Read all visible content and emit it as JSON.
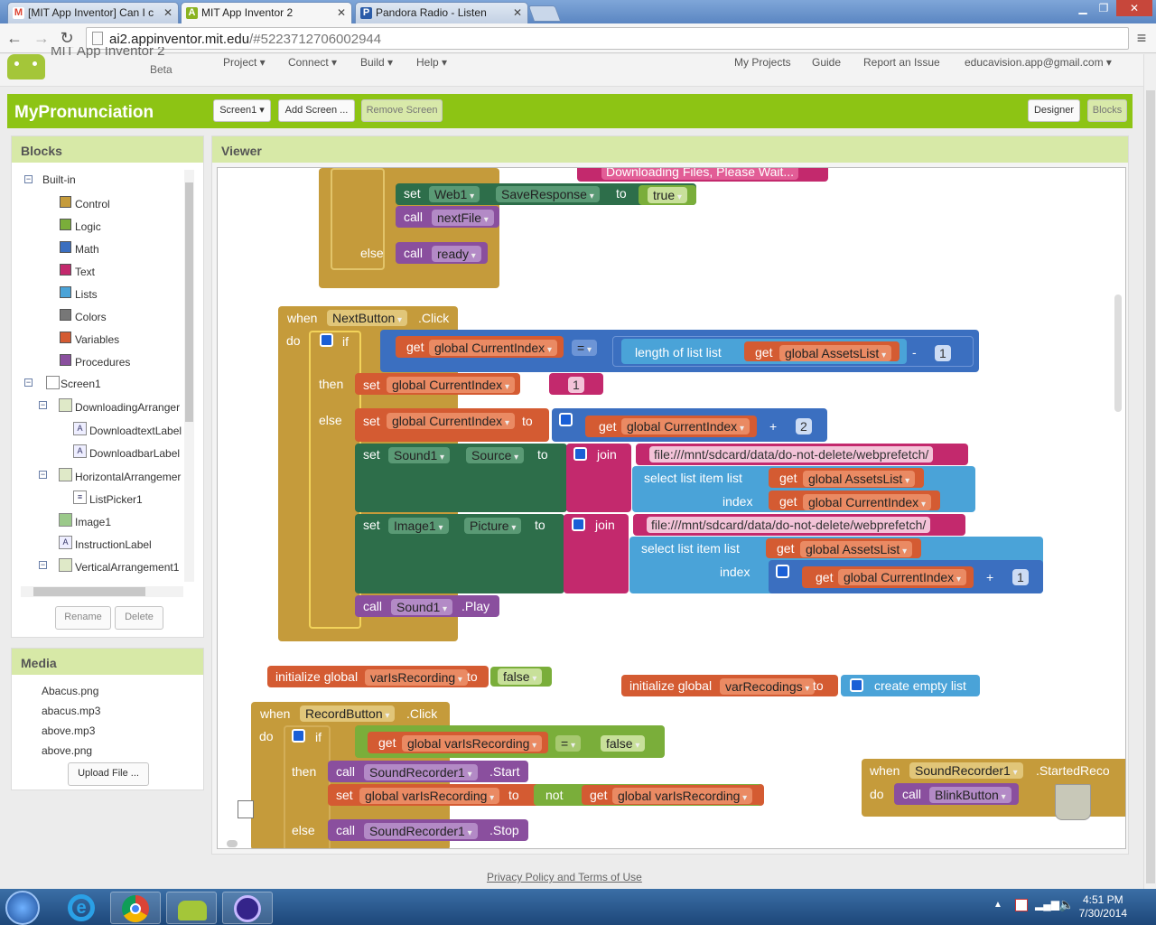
{
  "browser": {
    "tabs": [
      {
        "title": "[MIT App Inventor] Can I c",
        "icon": "M"
      },
      {
        "title": "MIT App Inventor 2",
        "icon": "A"
      },
      {
        "title": "Pandora Radio - Listen",
        "icon": "P"
      }
    ],
    "url_host": "ai2.appinventor.mit.edu",
    "url_path": "/#5223712706002944"
  },
  "header": {
    "brand": "MIT App Inventor 2",
    "beta": "Beta",
    "menus": [
      "Project ▾",
      "Connect ▾",
      "Build ▾",
      "Help ▾"
    ],
    "right_links": [
      "My Projects",
      "Guide",
      "Report an Issue",
      "educavision.app@gmail.com ▾"
    ]
  },
  "toolbar": {
    "project_name": "MyPronunciation",
    "screen_select": "Screen1 ▾",
    "add_screen": "Add Screen ...",
    "remove_screen": "Remove Screen",
    "designer": "Designer",
    "blocks": "Blocks"
  },
  "blocks_panel": {
    "title": "Blocks",
    "builtin": "Built-in",
    "builtin_items": [
      {
        "label": "Control",
        "color": "#c59b3b"
      },
      {
        "label": "Logic",
        "color": "#7aae3a"
      },
      {
        "label": "Math",
        "color": "#3b6fc0"
      },
      {
        "label": "Text",
        "color": "#c3296d"
      },
      {
        "label": "Lists",
        "color": "#4aa3d8"
      },
      {
        "label": "Colors",
        "color": "#777777"
      },
      {
        "label": "Variables",
        "color": "#d45b32"
      },
      {
        "label": "Procedures",
        "color": "#8a4f9e"
      }
    ],
    "screen": "Screen1",
    "components": {
      "downloading": "DownloadingArranger",
      "dl_text": "DownloadtextLabel",
      "dl_bar": "DownloadbarLabel",
      "horizontal": "HorizontalArrangemer",
      "listpicker": "ListPicker1",
      "image": "Image1",
      "instruction": "InstructionLabel",
      "vertical": "VerticalArrangement1"
    },
    "rename": "Rename",
    "delete": "Delete"
  },
  "media_panel": {
    "title": "Media",
    "files": [
      "Abacus.png",
      "abacus.mp3",
      "above.mp3",
      "above.png"
    ],
    "upload": "Upload File ..."
  },
  "viewer": {
    "title": "Viewer",
    "top_group": {
      "notice_text": "Downloading Files, Please Wait...",
      "notice": "notice",
      "set": "set",
      "web1": "Web1",
      "saveresponse": "SaveResponse",
      "to": "to",
      "true": "true",
      "call": "call",
      "nextfile": "nextFile",
      "else": "else",
      "ready": "ready"
    },
    "next_click": {
      "when": "when",
      "button": "NextButton",
      "event": ".Click",
      "do": "do",
      "if": "if",
      "get": "get",
      "currentindex": "global CurrentIndex",
      "eq": "=",
      "length": "length of list  list",
      "assetslist": "global AssetsList",
      "minus": "-",
      "one": "1",
      "then": "then",
      "set": "set",
      "to": "to",
      "quote_one": "1",
      "else": "else",
      "plus": "+",
      "two": "2",
      "sound1": "Sound1",
      "source": "Source",
      "join": "join",
      "path": "file:///mnt/sdcard/data/do-not-delete/webprefetch/",
      "select": "select list item  list",
      "index": "index",
      "image1": "Image1",
      "picture": "Picture",
      "call": "call",
      "play": ".Play"
    },
    "init_recording": {
      "init": "initialize global",
      "name": "varIsRecording",
      "to": "to",
      "value": "false"
    },
    "init_recodings": {
      "init": "initialize global",
      "name": "varRecodings",
      "to": "to",
      "value": "create empty list"
    },
    "record_click": {
      "when": "when",
      "button": "RecordButton",
      "event": ".Click",
      "do": "do",
      "if": "if",
      "get": "get",
      "isrec": "global varIsRecording",
      "eq": "=",
      "false": "false",
      "then": "then",
      "call": "call",
      "recorder": "SoundRecorder1",
      "start": ".Start",
      "set": "set",
      "to": "to",
      "not": "not",
      "else": "else",
      "stop": ".Stop"
    },
    "started": {
      "when": "when",
      "recorder": "SoundRecorder1",
      "event": ".StartedReco",
      "do": "do",
      "call": "call",
      "blink": "BlinkButton"
    }
  },
  "footer": {
    "privacy": "Privacy Policy and Terms of Use"
  },
  "taskbar": {
    "time": "4:51 PM",
    "date": "7/30/2014"
  }
}
